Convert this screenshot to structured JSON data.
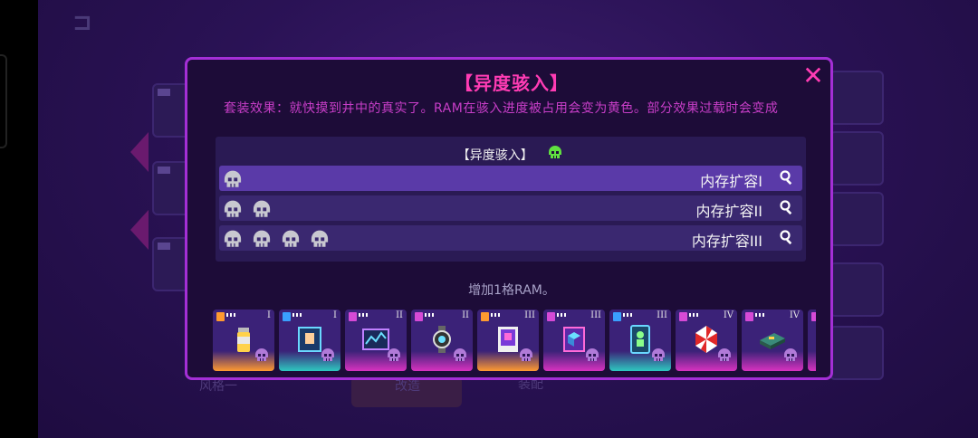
{
  "background": {
    "back_symbol": "⊐",
    "style_label": "风格一",
    "tab_labels": [
      "改造",
      "装配"
    ]
  },
  "modal": {
    "title": "【异度骇入】",
    "set_effect": "套装效果：就快摸到井中的真实了。RAM在骇入进度被占用会变为黄色。部分效果过载时会变成",
    "close_icon": "close-icon",
    "upgrade_header": "【异度骇入】",
    "tiers": [
      {
        "label": "内存扩容I",
        "skulls": 1,
        "active": true
      },
      {
        "label": "内存扩容II",
        "skulls": 2,
        "active": false
      },
      {
        "label": "内存扩容III",
        "skulls": 4,
        "active": false
      }
    ],
    "upgrade_desc": "增加1格RAM。",
    "chips": [
      {
        "rank": "I",
        "tag_color": "#ff9a30",
        "glow": "orange",
        "item": "spray-can-icon"
      },
      {
        "rank": "I",
        "tag_color": "#3aa0ff",
        "glow": "teal",
        "item": "hand-screen-icon"
      },
      {
        "rank": "II",
        "tag_color": "#d64ad6",
        "glow": "magenta",
        "item": "graph-monitor-icon"
      },
      {
        "rank": "II",
        "tag_color": "#d64ad6",
        "glow": "magenta",
        "item": "watch-icon"
      },
      {
        "rank": "III",
        "tag_color": "#ff9a30",
        "glow": "orange",
        "item": "card-frame-icon"
      },
      {
        "rank": "III",
        "tag_color": "#d64ad6",
        "glow": "magenta",
        "item": "cube-card-icon"
      },
      {
        "rank": "III",
        "tag_color": "#3aa0ff",
        "glow": "teal",
        "item": "phone-figure-icon"
      },
      {
        "rank": "IV",
        "tag_color": "#d64ad6",
        "glow": "magenta",
        "item": "umbrella-logo-icon"
      },
      {
        "rank": "IV",
        "tag_color": "#d64ad6",
        "glow": "magenta",
        "item": "circuit-board-icon"
      },
      {
        "rank": "",
        "tag_color": "#d64ad6",
        "glow": "magenta",
        "item": "partial-icon"
      }
    ]
  },
  "colors": {
    "accent_pink": "#ff3cb4",
    "border_purple": "#a42fd6",
    "skull_active": "#60e040",
    "skull_grey": "#c8c8d0",
    "skull_purple": "#b07ad8"
  }
}
